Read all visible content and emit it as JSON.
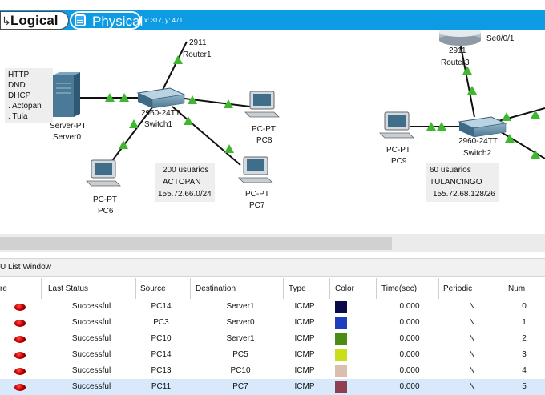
{
  "topbar": {
    "logical_label": "Logical",
    "physical_label": "Physical",
    "coords": "x: 317, y: 471"
  },
  "topology": {
    "labels": {
      "router1_model": "2911",
      "router1_name": "Router1",
      "switch1_model": "2960-24TT",
      "switch1_name": "Switch1",
      "server0_model": "Server-PT",
      "server0_name": "Server0",
      "pc8_model": "PC-PT",
      "pc8_name": "PC8",
      "pc6_model": "PC-PT",
      "pc6_name": "PC6",
      "pc7_model": "PC-PT",
      "pc7_name": "PC7",
      "router3_model": "2911",
      "router3_name": "Router3",
      "router3_port": "Se0/0/1",
      "switch2_model": "2960-24TT",
      "switch2_name": "Switch2",
      "pc9_model": "PC-PT",
      "pc9_name": "PC9"
    },
    "services_note": [
      "HTTP",
      "DND",
      "DHCP",
      ". Actopan",
      ". Tula"
    ],
    "note_actopan": [
      "200 usuarios",
      "ACTOPAN",
      "155.72.66.0/24"
    ],
    "note_tulancingo": [
      "60 usuarios",
      "TULANCINGO",
      "155.72.68.128/26"
    ]
  },
  "pdu_window": {
    "title": "U List Window",
    "columns": [
      "re",
      "Last Status",
      "Source",
      "Destination",
      "Type",
      "Color",
      "Time(sec)",
      "Periodic",
      "Num"
    ],
    "rows": [
      {
        "status": "Successful",
        "source": "PC14",
        "destination": "Server1",
        "type": "ICMP",
        "color": "#0a0a4a",
        "time": "0.000",
        "periodic": "N",
        "num": "0"
      },
      {
        "status": "Successful",
        "source": "PC3",
        "destination": "Server0",
        "type": "ICMP",
        "color": "#1f3ebd",
        "time": "0.000",
        "periodic": "N",
        "num": "1"
      },
      {
        "status": "Successful",
        "source": "PC10",
        "destination": "Server1",
        "type": "ICMP",
        "color": "#4a8c14",
        "time": "0.000",
        "periodic": "N",
        "num": "2"
      },
      {
        "status": "Successful",
        "source": "PC14",
        "destination": "PC5",
        "type": "ICMP",
        "color": "#c7e01a",
        "time": "0.000",
        "periodic": "N",
        "num": "3"
      },
      {
        "status": "Successful",
        "source": "PC13",
        "destination": "PC10",
        "type": "ICMP",
        "color": "#d9bfae",
        "time": "0.000",
        "periodic": "N",
        "num": "4"
      },
      {
        "status": "Successful",
        "source": "PC11",
        "destination": "PC7",
        "type": "ICMP",
        "color": "#8e3f52",
        "time": "0.000",
        "periodic": "N",
        "num": "5"
      }
    ]
  },
  "colors": {
    "bar_blue": "#0d9be3",
    "link_green": "#3fb72f",
    "selected_row": "#d7e9fb"
  }
}
